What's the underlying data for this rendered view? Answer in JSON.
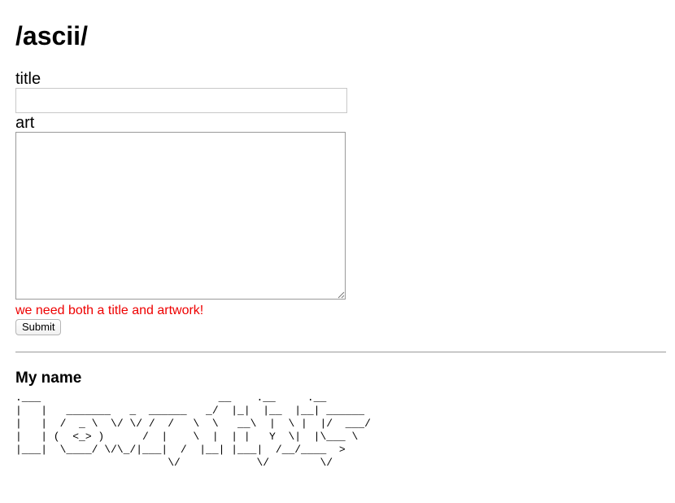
{
  "header": {
    "title": "/ascii/"
  },
  "form": {
    "title_label": "title",
    "title_value": "",
    "art_label": "art",
    "art_value": "",
    "error_message": "we need both a title and artwork!",
    "submit_label": "Submit"
  },
  "artworks": [
    {
      "title": "My name",
      "art": ".___                            __    .__     .__\n|   |   _______   _  ______   _/  |_|  |__  |__| ______\n|   |  /  _ \\  \\/ \\/ /  /   \\  \\   __\\  |  \\ |  |/  ___/\n|   | (  <_> )      /  |    \\  |  | |   Y  \\|  |\\___ \\\n|___|  \\____/ \\/\\_/|___|  /  |__| |___|  /__/____  >\n                        \\/            \\/        \\/"
    }
  ]
}
